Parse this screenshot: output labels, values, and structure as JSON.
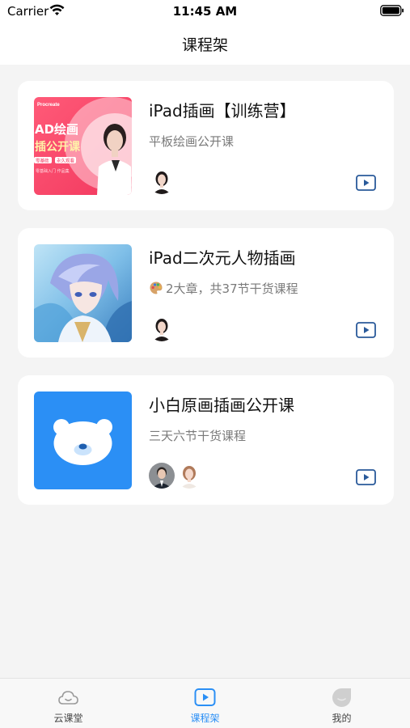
{
  "status_bar": {
    "carrier": "Carrier",
    "time": "11:45 AM",
    "icons": [
      "wifi-icon",
      "battery-icon"
    ]
  },
  "nav": {
    "title": "课程架"
  },
  "courses": [
    {
      "title": "iPad插画【训练营】",
      "subtitle": "平板绘画公开课",
      "thumb": {
        "brand": "Procreate",
        "line1": "AD绘画",
        "line2": "插公开课",
        "tag1": "零基础",
        "tag2": "永久观看",
        "bottom": "零基础入门 作品集"
      },
      "teachers": [
        "teacher-avatar-female"
      ]
    },
    {
      "title": "iPad二次元人物插画",
      "subtitle": "2大章，共37节干货课程",
      "subtitle_icon": "palette-icon",
      "teachers": [
        "teacher-avatar-female"
      ]
    },
    {
      "title": "小白原画插画公开课",
      "subtitle": "三天六节干货课程",
      "teachers": [
        "teacher-avatar-male",
        "teacher-avatar-female"
      ]
    }
  ],
  "tabs": [
    {
      "label": "云课堂",
      "icon": "cloud-icon",
      "active": false
    },
    {
      "label": "课程架",
      "icon": "play-icon",
      "active": true
    },
    {
      "label": "我的",
      "icon": "profile-icon",
      "active": false
    }
  ],
  "colors": {
    "accent": "#2b8ff5",
    "background": "#f4f4f4",
    "play_icon": "#2a5a9a",
    "bear_bg": "#2b8ff5"
  }
}
